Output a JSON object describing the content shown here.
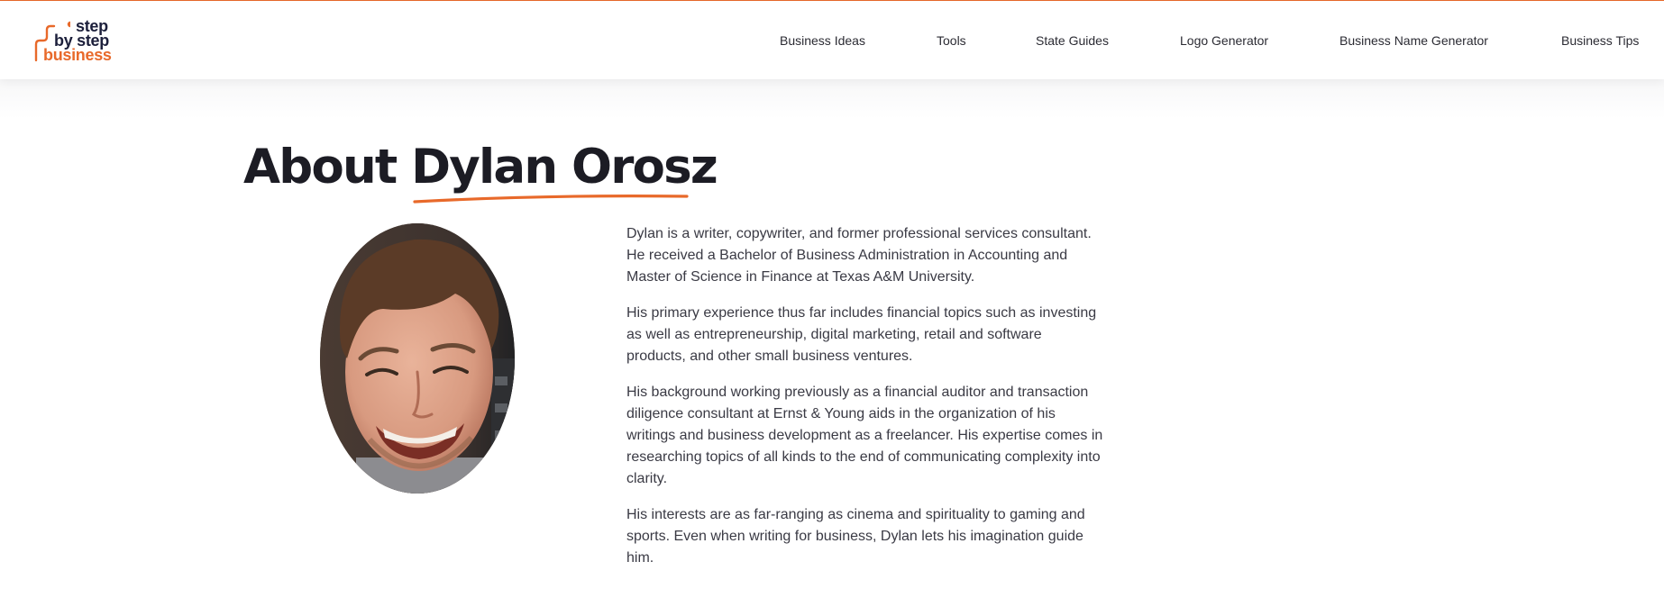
{
  "logo": {
    "line1": "step",
    "line2": "by step",
    "line3": "business",
    "colors": {
      "navy": "#1c1f3b",
      "orange": "#e8692a"
    }
  },
  "nav": {
    "items": [
      {
        "label": "Business Ideas"
      },
      {
        "label": "Tools"
      },
      {
        "label": "State Guides"
      },
      {
        "label": "Logo Generator"
      },
      {
        "label": "Business Name Generator"
      },
      {
        "label": "Business Tips"
      }
    ]
  },
  "page": {
    "title_prefix": "About ",
    "title_name": "Dylan Orosz"
  },
  "photo": {
    "alt": "Dylan Orosz"
  },
  "bio": {
    "paragraphs": [
      "Dylan is a writer, copywriter, and former professional services consultant. He received a Bachelor of Business Administration in Accounting and Master of Science in Finance at Texas A&M University.",
      "His primary experience thus far includes financial topics such as investing as well as entrepreneurship, digital marketing, retail and software products, and other small business ventures.",
      "His background working previously as a financial auditor and transaction diligence consultant at Ernst & Young aids in the organization of his writings and business development as a freelancer. His expertise comes in researching topics of all kinds to the end of communicating complexity into clarity.",
      "His interests are as far-ranging as cinema and spirituality to gaming and sports. Even when writing for business, Dylan lets his imagination guide him."
    ]
  },
  "theme": {
    "accent": "#e8692a",
    "text": "#2b2b33",
    "heading": "#1c1c24"
  }
}
